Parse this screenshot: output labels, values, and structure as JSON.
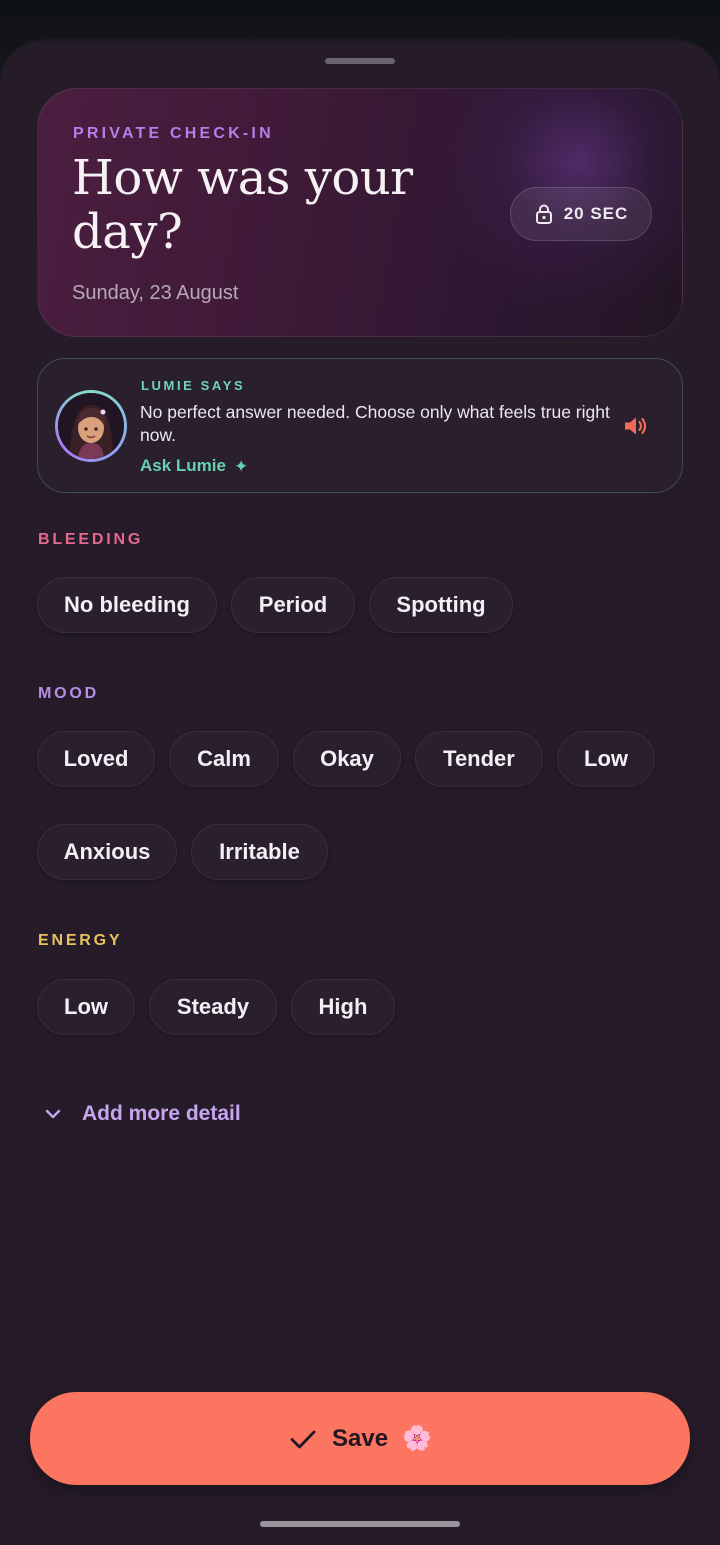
{
  "header": {
    "eyebrow": "PRIVATE CHECK-IN",
    "title": "How was your day?",
    "date": "Sunday, 23 August",
    "timer": "20 SEC"
  },
  "lumie": {
    "eyebrow": "LUMIE SAYS",
    "message": "No perfect answer needed. Choose only what feels true right now.",
    "ask_label": "Ask Lumie",
    "ask_icon": "sparkle-icon",
    "speaker_icon": "speaker-icon"
  },
  "sections": {
    "bleeding": {
      "label": "BLEEDING",
      "color": "#e46a8d",
      "options": [
        "No bleeding",
        "Period",
        "Spotting"
      ]
    },
    "mood": {
      "label": "MOOD",
      "color": "#b48fe4",
      "options": [
        "Loved",
        "Calm",
        "Okay",
        "Tender",
        "Low",
        "Anxious",
        "Irritable"
      ]
    },
    "energy": {
      "label": "ENERGY",
      "color": "#e8c25f",
      "options": [
        "Low",
        "Steady",
        "High"
      ]
    }
  },
  "more": {
    "label": "Add more detail",
    "icon": "chevron-down-icon"
  },
  "save": {
    "label": "Save",
    "emoji": "🌸",
    "icon": "check-icon"
  },
  "colors": {
    "accent": "#fb7561",
    "sheet": "#261c29",
    "lumie_accent": "#66d1b1"
  }
}
